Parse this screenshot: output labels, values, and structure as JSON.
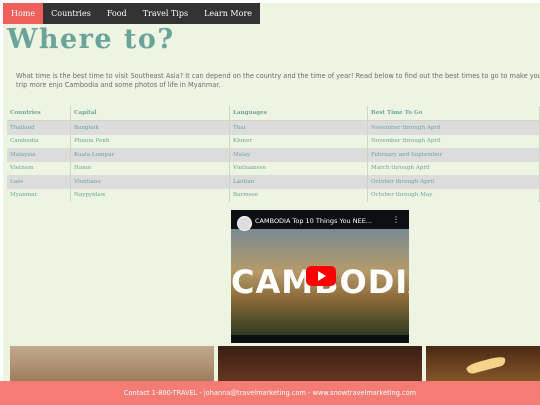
{
  "nav": {
    "items": [
      {
        "label": "Home",
        "active": true
      },
      {
        "label": "Countries",
        "active": false
      },
      {
        "label": "Food",
        "active": false
      },
      {
        "label": "Travel Tips",
        "active": false
      },
      {
        "label": "Learn More",
        "active": false
      }
    ]
  },
  "page": {
    "title": "Where to?",
    "intro": "What time is the best time to visit Southeast Asia? It can depend on the country and the time of year! Read below to find out the best times to go to make your trip more enjo Cambodia and some photos of life in Myanmar."
  },
  "table": {
    "headers": [
      "Countries",
      "Capital",
      "Languages",
      "Best Time To Go"
    ],
    "rows": [
      [
        "Thailand",
        "Bangkok",
        "Thai",
        "November through April"
      ],
      [
        "Cambodia",
        "Phnom Penh",
        "Khmer",
        "November through April"
      ],
      [
        "Malaysia",
        "Kuala Lumpur",
        "Malay",
        "February and September"
      ],
      [
        "Vietnam",
        "Hanoi",
        "Vietnamese",
        "March through April"
      ],
      [
        "Laos",
        "Vientiane",
        "Laotian",
        "October through April"
      ],
      [
        "Myanmar",
        "Naypyidaw",
        "Burmese",
        "October through May"
      ]
    ]
  },
  "video": {
    "title": "CAMBODIA Top 10 Things You NEE...",
    "overlay_text": "CAMBODIA",
    "menu_glyph": "⋮"
  },
  "footer": {
    "prefix": "Contact 1-800-TRAVEL - ",
    "email": "johanna@travelmarketing.com",
    "separator": " - ",
    "website": "www.snowtravelmarketing.com"
  },
  "colors": {
    "accent": "#6aa39a",
    "nav_active": "#f0605a",
    "nav_bg": "#333333",
    "page_bg": "#eef4e2",
    "footer_bg": "#f47c74"
  }
}
